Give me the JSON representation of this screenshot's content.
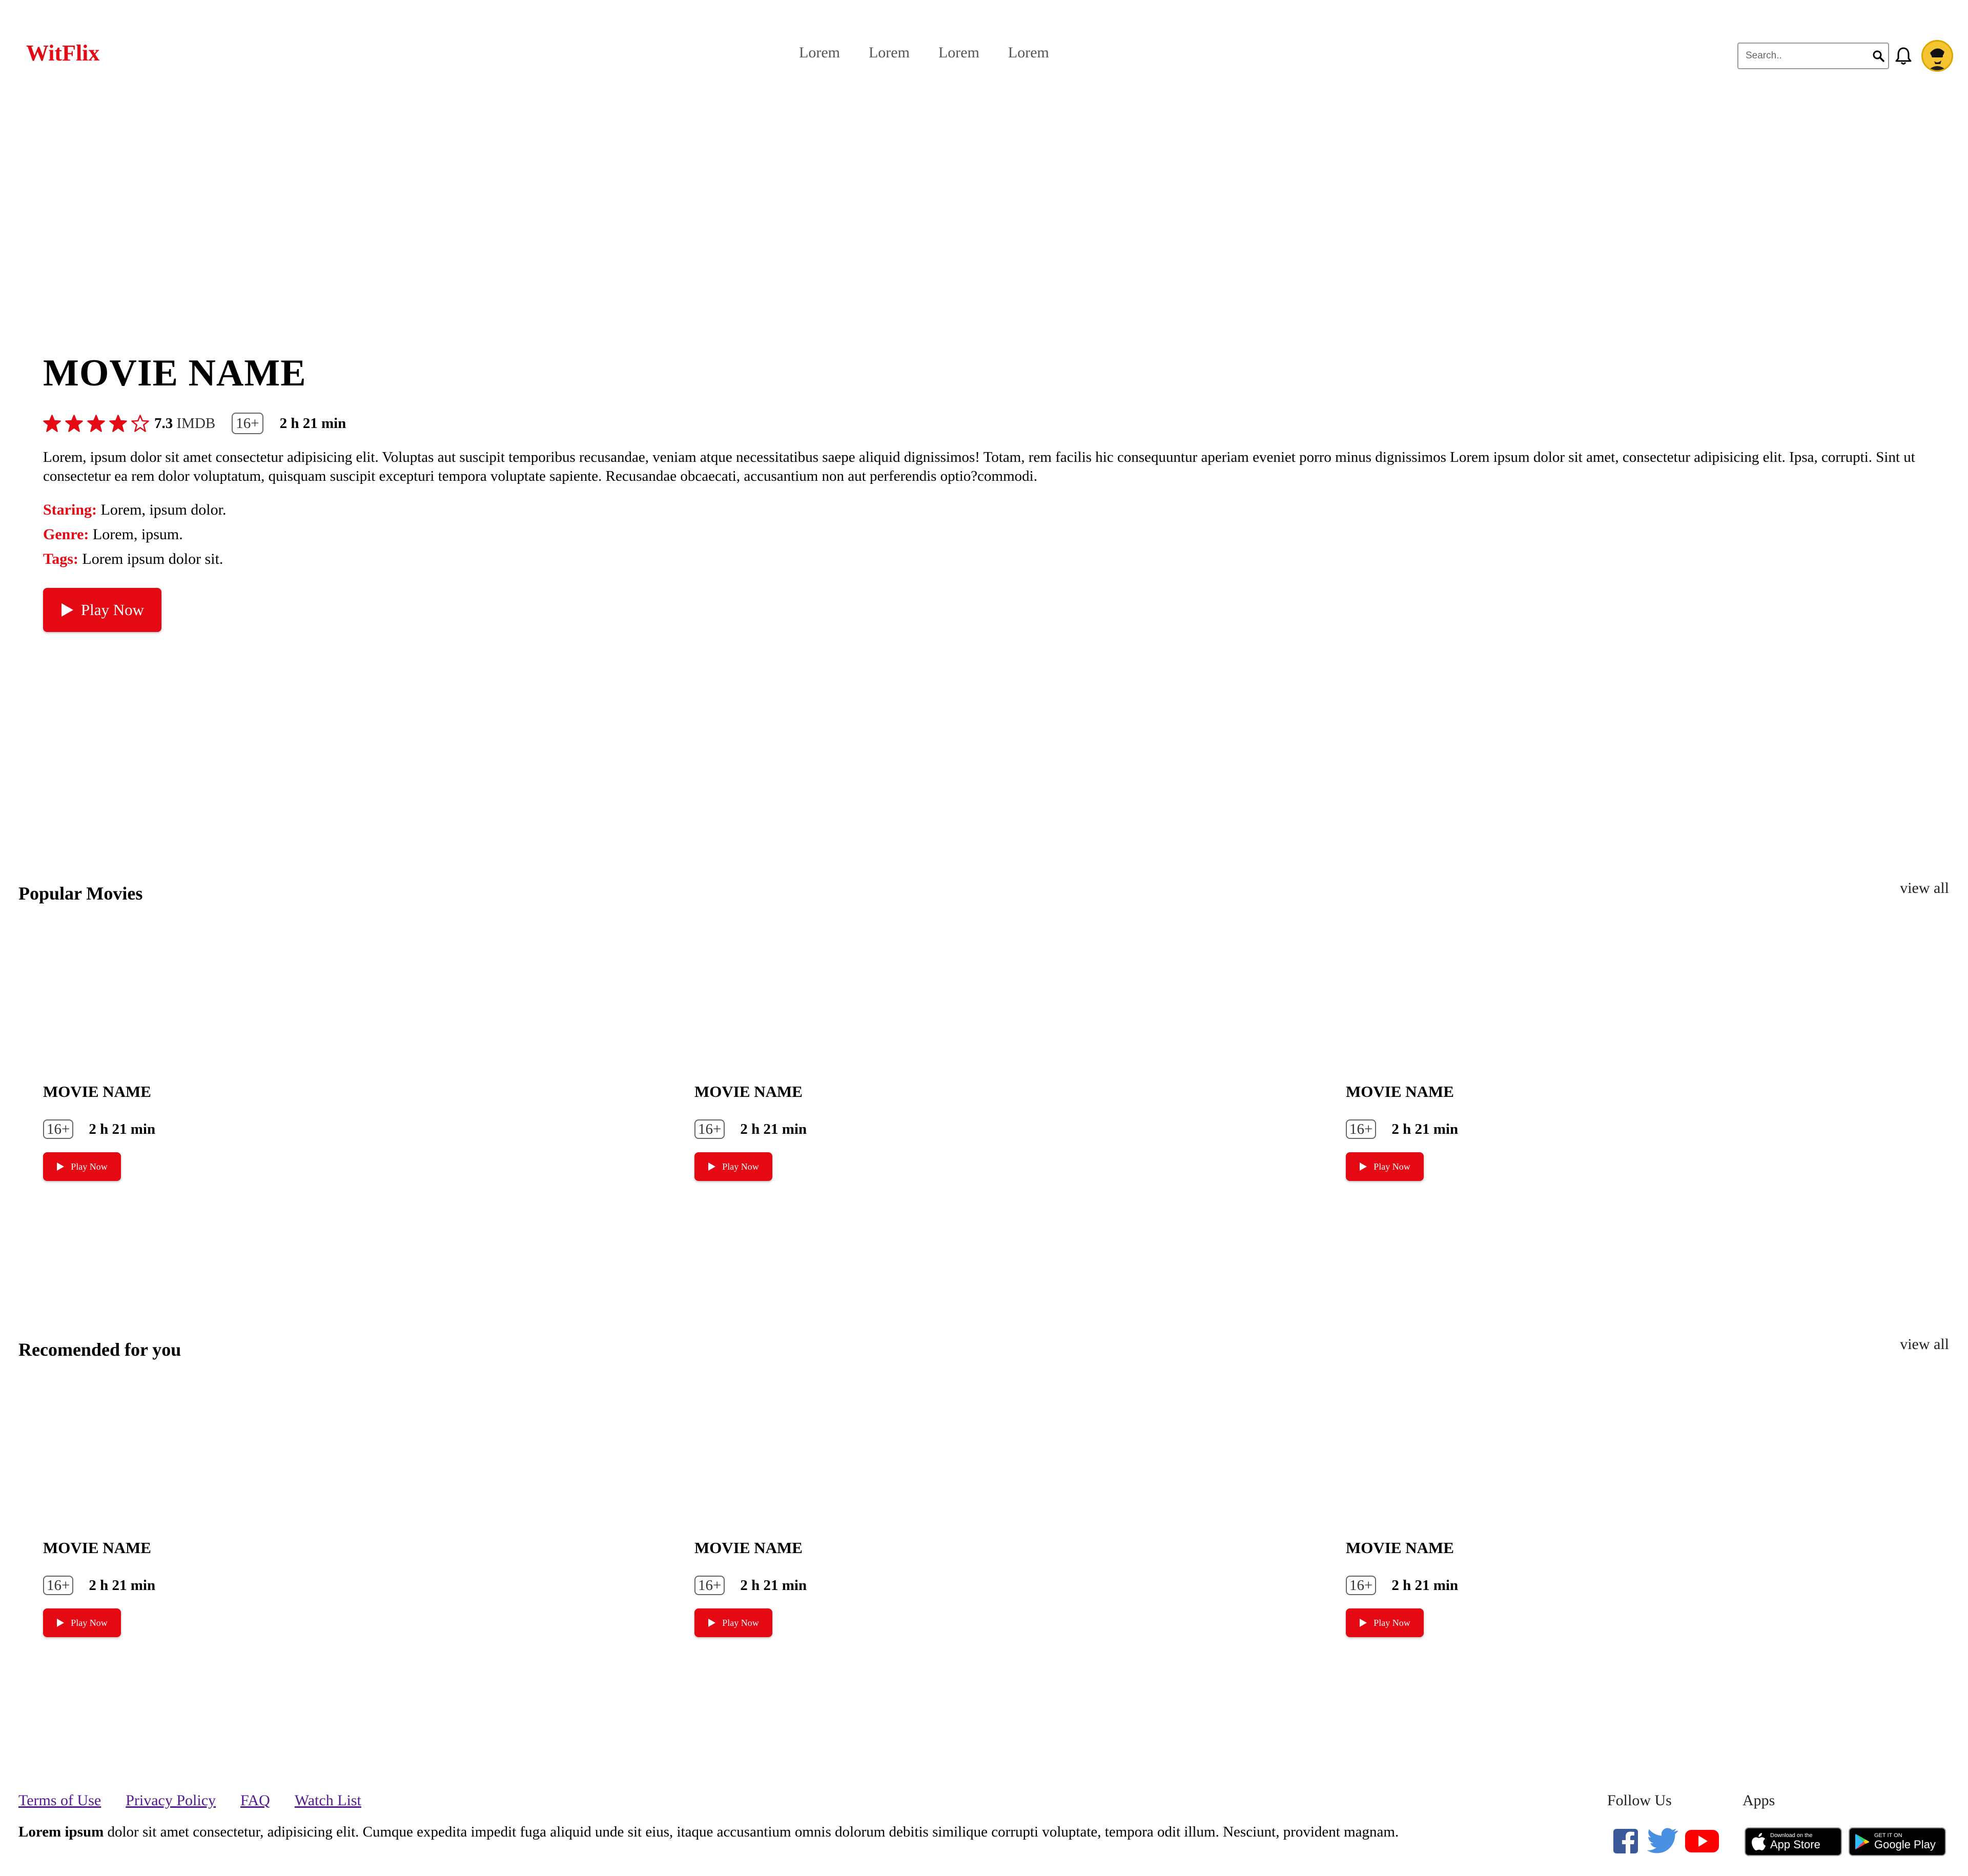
{
  "brand": {
    "logo": "WitFlix",
    "accent_color": "#e50914"
  },
  "nav": {
    "links": [
      "Lorem",
      "Lorem",
      "Lorem",
      "Lorem"
    ]
  },
  "search": {
    "placeholder": "Search.."
  },
  "hero": {
    "title": "MOVIE NAME",
    "rating_stars": 4,
    "rating_max": 5,
    "rating_value": "7.3",
    "rating_source": "IMDB",
    "age": "16+",
    "duration": "2 h 21 min",
    "description": "Lorem, ipsum dolor sit amet consectetur adipisicing elit. Voluptas aut suscipit temporibus recusandae, veniam atque necessitatibus saepe aliquid dignissimos! Totam, rem facilis hic consequuntur aperiam eveniet porro minus dignissimos Lorem ipsum dolor sit amet, consectetur adipisicing elit. Ipsa, corrupti. Sint ut consectetur ea rem dolor voluptatum, quisquam suscipit excepturi tempora voluptate sapiente. Recusandae obcaecati, accusantium non aut perferendis optio?commodi.",
    "starring_label": "Staring:",
    "starring": "Lorem, ipsum dolor.",
    "genre_label": "Genre:",
    "genre": "Lorem, ipsum.",
    "tags_label": "Tags:",
    "tags": "Lorem ipsum dolor sit.",
    "play_label": "Play Now"
  },
  "popular": {
    "title": "Popular Movies",
    "view_all": "view all",
    "cards": [
      {
        "title": "MOVIE NAME",
        "age": "16+",
        "duration": "2 h 21 min",
        "play_label": "Play Now"
      },
      {
        "title": "MOVIE NAME",
        "age": "16+",
        "duration": "2 h 21 min",
        "play_label": "Play Now"
      },
      {
        "title": "MOVIE NAME",
        "age": "16+",
        "duration": "2 h 21 min",
        "play_label": "Play Now"
      }
    ]
  },
  "recommended": {
    "title": "Recomended for you",
    "view_all": "view all",
    "cards": [
      {
        "title": "MOVIE NAME",
        "age": "16+",
        "duration": "2 h 21 min",
        "play_label": "Play Now"
      },
      {
        "title": "MOVIE NAME",
        "age": "16+",
        "duration": "2 h 21 min",
        "play_label": "Play Now"
      },
      {
        "title": "MOVIE NAME",
        "age": "16+",
        "duration": "2 h 21 min",
        "play_label": "Play Now"
      }
    ]
  },
  "footer": {
    "links": [
      "Terms of Use",
      "Privacy Policy",
      "FAQ",
      "Watch List"
    ],
    "text_bold": "Lorem ipsum",
    "text": " dolor sit amet consectetur, adipisicing elit. Cumque expedita impedit fuga aliquid unde sit eius, itaque accusantium omnis dolorum debitis similique corrupti voluptate, tempora odit illum. Nesciunt, provident magnam.",
    "follow_label": "Follow Us",
    "apps_label": "Apps",
    "social_icons": [
      "facebook-icon",
      "twitter-icon",
      "youtube-icon"
    ],
    "app_store": {
      "small": "Download on the",
      "big": "App Store"
    },
    "google_play": {
      "small": "GET IT ON",
      "big": "Google Play"
    }
  },
  "colors": {
    "facebook": "#3b5998",
    "twitter": "#1da1f2",
    "youtube": "#ff0000",
    "badge_bg": "#000000"
  }
}
